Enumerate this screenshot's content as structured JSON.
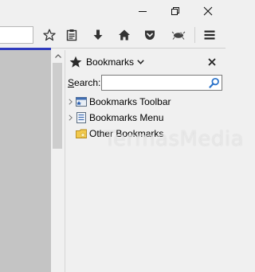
{
  "window": {
    "minimize_icon": "minimize-icon",
    "restore_icon": "restore-icon",
    "close_icon": "close-icon"
  },
  "toolbar": {
    "icons": [
      "star-icon",
      "clipboard-list-icon",
      "download-arrow-icon",
      "home-icon",
      "pocket-icon",
      "extension-icon",
      "hamburger-menu-icon"
    ]
  },
  "sidebar": {
    "title": "Bookmarks",
    "search": {
      "label_accel": "S",
      "label_rest": "earch:",
      "value": "",
      "placeholder": ""
    },
    "items": [
      {
        "label": "Bookmarks Toolbar",
        "icon": "bookmarks-toolbar-icon",
        "expandable": true
      },
      {
        "label": "Bookmarks Menu",
        "icon": "bookmarks-menu-icon",
        "expandable": true
      },
      {
        "label": "Other Bookmarks",
        "icon": "folder-star-icon",
        "expandable": false
      }
    ]
  },
  "watermark": "TermasMedia",
  "colors": {
    "accent_line": "#2f3bbd",
    "content_bg": "#c4c4c4",
    "chrome_bg": "#f0f0f0",
    "search_icon": "#2a72c9"
  }
}
